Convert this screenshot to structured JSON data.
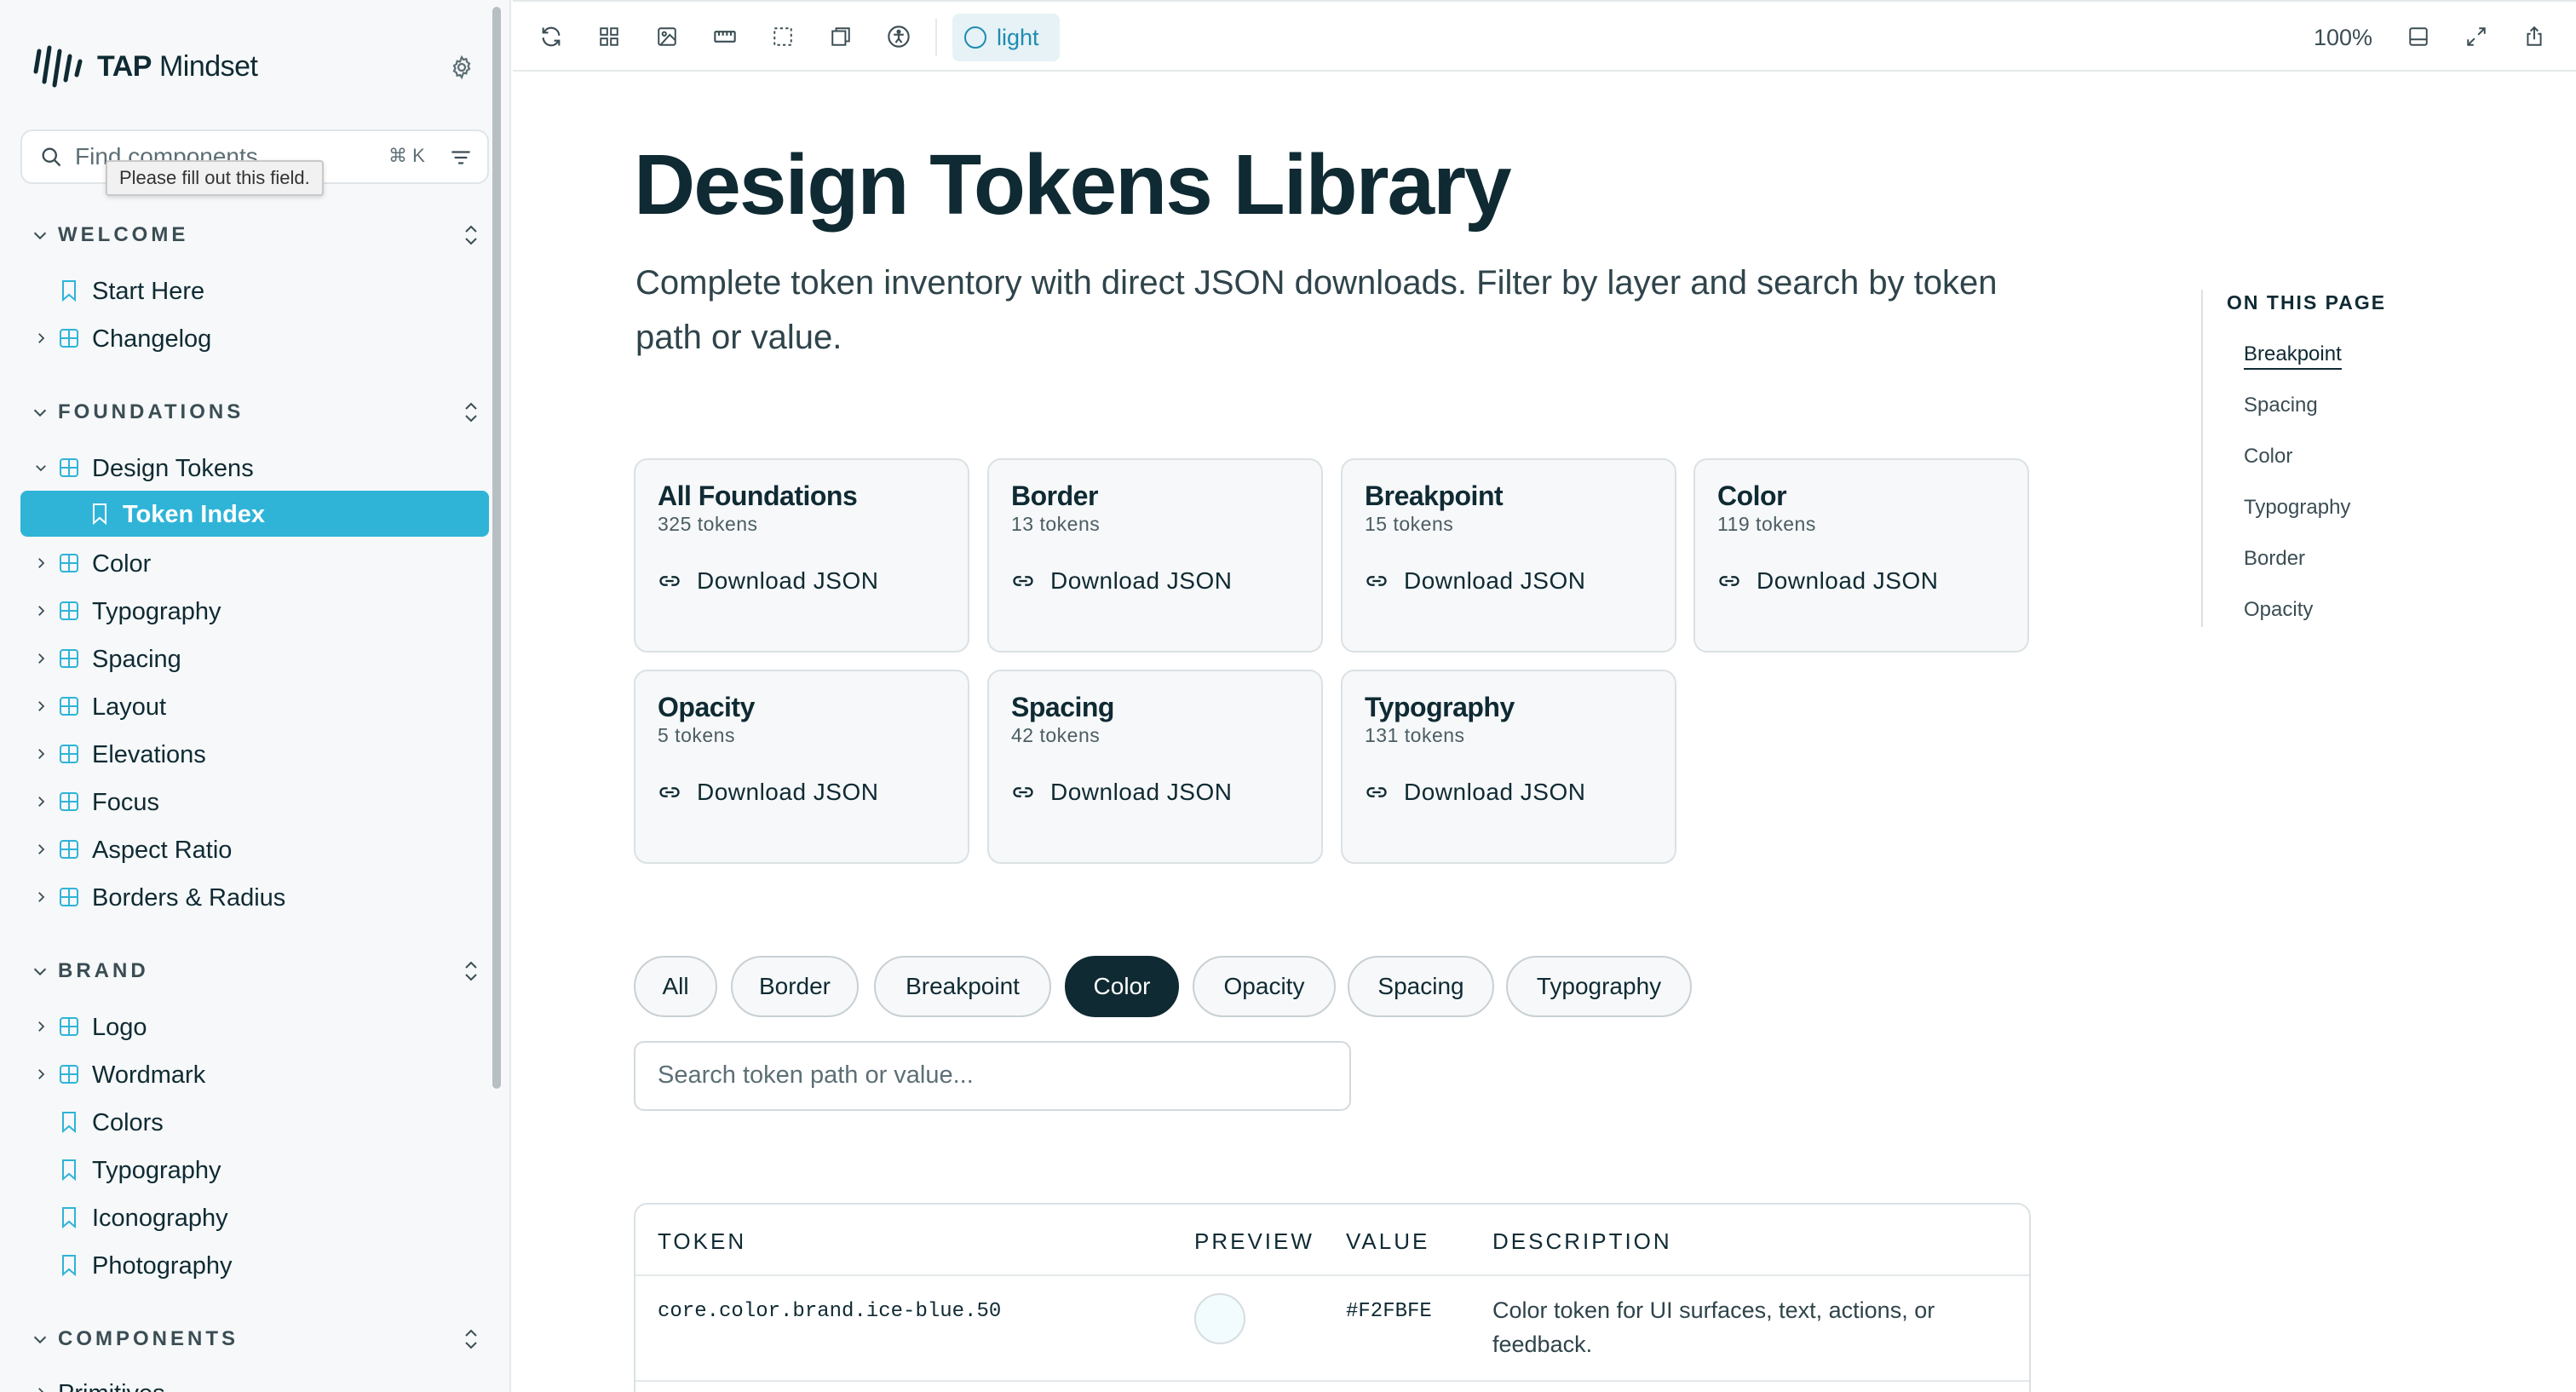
{
  "sidebar": {
    "brand": {
      "mark": "TAP",
      "name": "Mindset"
    },
    "search": {
      "placeholder": "Find components",
      "shortcut": "⌘ K",
      "tooltip": "Please fill out this field."
    },
    "sections": [
      {
        "label": "WELCOME"
      },
      {
        "label": "FOUNDATIONS"
      },
      {
        "label": "BRAND"
      },
      {
        "label": "COMPONENTS"
      }
    ],
    "items": {
      "start_here": "Start Here",
      "changelog": "Changelog",
      "design_tokens": "Design Tokens",
      "token_index": "Token Index",
      "color": "Color",
      "typography": "Typography",
      "spacing": "Spacing",
      "layout": "Layout",
      "elevations": "Elevations",
      "focus": "Focus",
      "aspect_ratio": "Aspect Ratio",
      "borders_radius": "Borders & Radius",
      "logo": "Logo",
      "wordmark": "Wordmark",
      "brand_colors": "Colors",
      "brand_typography": "Typography",
      "iconography": "Iconography",
      "photography": "Photography",
      "primitives": "Primitives"
    }
  },
  "toolbar": {
    "theme_label": "light",
    "zoom": "100%",
    "icons": [
      "refresh-icon",
      "grid-icon",
      "image-icon",
      "ruler-icon",
      "outline-icon",
      "viewport-icon",
      "accessibility-icon",
      "panel-icon",
      "fullscreen-icon",
      "share-icon"
    ]
  },
  "main": {
    "title": "Design Tokens Library",
    "subtitle": "Complete token inventory with direct JSON downloads. Filter by layer and search by token path or value.",
    "download_label": "Download JSON",
    "cards": [
      {
        "title": "All Foundations",
        "count": "325 tokens"
      },
      {
        "title": "Border",
        "count": "13 tokens"
      },
      {
        "title": "Breakpoint",
        "count": "15 tokens"
      },
      {
        "title": "Color",
        "count": "119 tokens"
      },
      {
        "title": "Opacity",
        "count": "5 tokens"
      },
      {
        "title": "Spacing",
        "count": "42 tokens"
      },
      {
        "title": "Typography",
        "count": "131 tokens"
      }
    ],
    "filters": [
      "All",
      "Border",
      "Breakpoint",
      "Color",
      "Opacity",
      "Spacing",
      "Typography"
    ],
    "active_filter": "Color",
    "token_search_placeholder": "Search token path or value...",
    "table": {
      "headers": [
        "TOKEN",
        "PREVIEW",
        "VALUE",
        "DESCRIPTION"
      ],
      "rows": [
        {
          "token": "core.color.brand.ice-blue.50",
          "value": "#F2FBFE",
          "description": "Color token for UI surfaces, text, actions, or feedback."
        }
      ]
    }
  },
  "toc": {
    "title": "ON THIS PAGE",
    "links": [
      "Breakpoint",
      "Spacing",
      "Color",
      "Typography",
      "Border",
      "Opacity"
    ],
    "active": "Breakpoint"
  },
  "colors": {
    "accent": "#2fb4d8",
    "ink": "#0f2a33",
    "theme_accent": "#1e8bb0",
    "surface": "#f6f8f9"
  }
}
